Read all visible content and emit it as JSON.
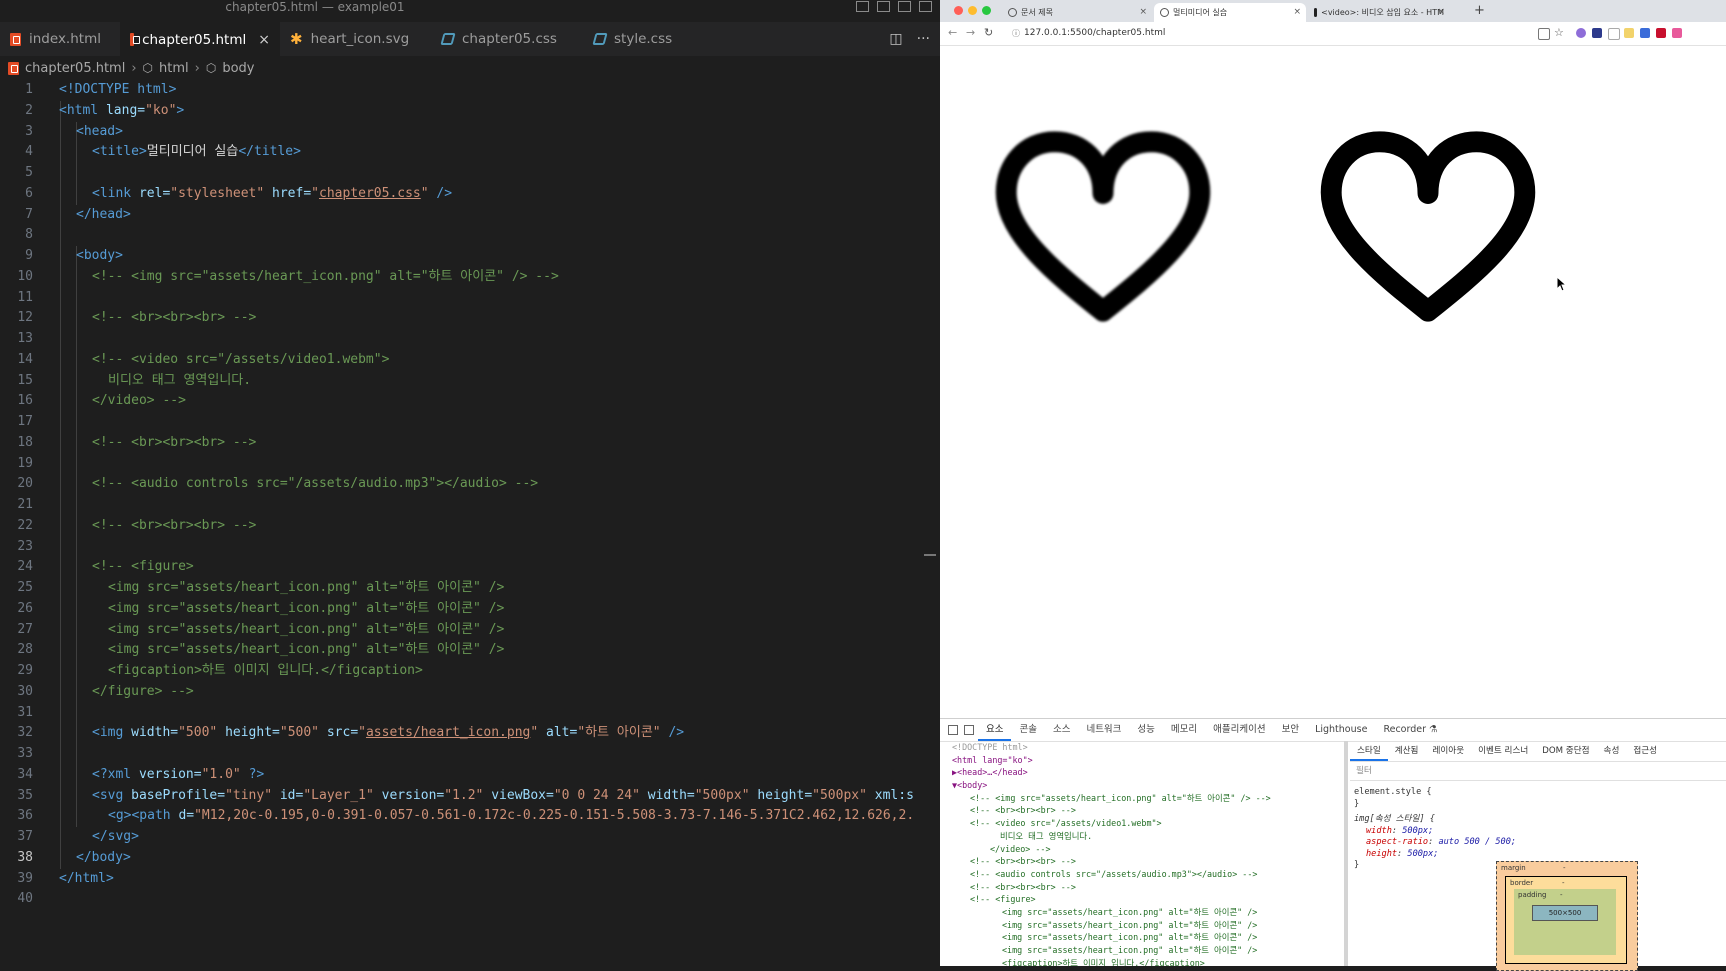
{
  "editor": {
    "window_title": "chapter05.html — example01",
    "tabs": [
      {
        "label": "index.html",
        "icon": "html-file-icon"
      },
      {
        "label": "chapter05.html",
        "icon": "html-file-icon",
        "active": true
      },
      {
        "label": "heart_icon.svg",
        "icon": "svg-file-icon"
      },
      {
        "label": "chapter05.css",
        "icon": "css-file-icon"
      },
      {
        "label": "style.css",
        "icon": "css-file-icon"
      }
    ],
    "tab_close": "×",
    "actions": {
      "split": "◫",
      "more": "···"
    },
    "breadcrumb": {
      "file": "chapter05.html",
      "html": "html",
      "body": "body"
    },
    "lines": {
      "l1": "<!DOCTYPE html>",
      "l2_tag": "<html ",
      "l2_attr": "lang=",
      "l2_val": "\"ko\"",
      "l2_end": ">",
      "l3": "<head>",
      "l4_tag1": "<title>",
      "l4_text": "멀티미디어 실습",
      "l4_tag2": "</title>",
      "l6_tag": "<link ",
      "l6_a1": "rel=",
      "l6_v1": "\"stylesheet\" ",
      "l6_a2": "href=",
      "l6_v2q": "\"",
      "l6_v2": "chapter05.css",
      "l6_v2e": "\" ",
      "l6_end": "/>",
      "l7": "</head>",
      "l9": "<body>",
      "l10": "<!-- <img src=\"assets/heart_icon.png\" alt=\"하트 아이콘\" /> -->",
      "l12": "<!-- <br><br><br> -->",
      "l14": "<!-- <video src=\"/assets/video1.webm\">",
      "l15": "비디오 태그 영역입니다.",
      "l16": "</video> -->",
      "l18": "<!-- <br><br><br> -->",
      "l20": "<!-- <audio controls src=\"/assets/audio.mp3\"></audio> -->",
      "l22": "<!-- <br><br><br> -->",
      "l24": "<!-- <figure>",
      "l25": "<img src=\"assets/heart_icon.png\" alt=\"하트 아이콘\" />",
      "l26": "<img src=\"assets/heart_icon.png\" alt=\"하트 아이콘\" />",
      "l27": "<img src=\"assets/heart_icon.png\" alt=\"하트 아이콘\" />",
      "l28": "<img src=\"assets/heart_icon.png\" alt=\"하트 아이콘\" />",
      "l29": "<figcaption>하트 이미지 입니다.</figcaption>",
      "l30": "</figure> -->",
      "l32_tag": "<img ",
      "l32_a1": "width=",
      "l32_v1": "\"500\" ",
      "l32_a2": "height=",
      "l32_v2": "\"500\" ",
      "l32_a3": "src=",
      "l32_v3q": "\"",
      "l32_v3": "assets/heart_icon.png",
      "l32_v3e": "\" ",
      "l32_a4": "alt=",
      "l32_v4": "\"하트 아이콘\" ",
      "l32_end": "/>",
      "l34_tag": "<?xml ",
      "l34_a": "version=",
      "l34_v": "\"1.0\" ",
      "l34_end": "?>",
      "l35_tag": "<svg ",
      "l35_a1": "baseProfile=",
      "l35_v1": "\"tiny\" ",
      "l35_a2": "id=",
      "l35_v2": "\"Layer_1\" ",
      "l35_a3": "version=",
      "l35_v3": "\"1.2\" ",
      "l35_a4": "viewBox=",
      "l35_v4": "\"0 0 24 24\" ",
      "l35_a5": "width=",
      "l35_v5": "\"500px\" ",
      "l35_a6": "height=",
      "l35_v6": "\"500px\" ",
      "l35_a7": "xml:s",
      "l36_tag": "<g><path ",
      "l36_a": "d=",
      "l36_v": "\"M12,20c-0.195,0-0.391-0.057-0.561-0.172c-0.225-0.151-5.508-3.73-7.146-5.371C2.462,12.626,2.",
      "l37": "</svg>",
      "l38": "</body>",
      "l39": "</html>"
    }
  },
  "browser": {
    "tabs": [
      {
        "label": "문서 제목"
      },
      {
        "label": "멀티미디어 실습",
        "active": true
      },
      {
        "label": "<video>: 비디오 삽입 요소 - HTM"
      }
    ],
    "tab_close": "×",
    "new_tab": "+",
    "url": "127.0.0.1:5500/chapter05.html",
    "nav": {
      "back": "←",
      "forward": "→",
      "reload": "↻"
    },
    "heart_alt": "하트 아이콘"
  },
  "devtools": {
    "tabs": [
      "요소",
      "콘솔",
      "소스",
      "네트워크",
      "성능",
      "메모리",
      "애플리케이션",
      "보안",
      "Lighthouse",
      "Recorder ⚗"
    ],
    "dom": {
      "d1": "<!DOCTYPE html>",
      "d2": "<html lang=\"ko\">",
      "d3": "▶<head>…</head>",
      "d4": "▼<body>",
      "d5": "<!-- <img src=\"assets/heart_icon.png\" alt=\"하트 아이콘\" /> -->",
      "d6": "<!-- <br><br><br> -->",
      "d7": "<!-- <video src=\"/assets/video1.webm\">",
      "d8": "비디오 태그 영역입니다.",
      "d9": "</video> -->",
      "d10": "<!-- <br><br><br> -->",
      "d11": "<!-- <audio controls src=\"/assets/audio.mp3\"></audio> -->",
      "d12": "<!-- <br><br><br> -->",
      "d13": "<!-- <figure>",
      "d14": "<img src=\"assets/heart_icon.png\" alt=\"하트 아이콘\" />",
      "d15": "<img src=\"assets/heart_icon.png\" alt=\"하트 아이콘\" />",
      "d16": "<img src=\"assets/heart_icon.png\" alt=\"하트 아이콘\" />",
      "d17": "<img src=\"assets/heart_icon.png\" alt=\"하트 아이콘\" />",
      "d18": "<figcaption>하트 이미지 입니다.</figcaption>"
    },
    "styles_tabs": [
      "스타일",
      "계산됨",
      "레이아웃",
      "이벤트 리스너",
      "DOM 중단점",
      "속성",
      "접근성"
    ],
    "filter_placeholder": "필터",
    "rules": {
      "r1": "element.style {",
      "r2": "}",
      "r3": "img[속성 스타일] {",
      "r4n": "width",
      "r4v": "500px;",
      "r5n": "aspect-ratio",
      "r5v": "auto 500 / 500;",
      "r6n": "height",
      "r6v": "500px;",
      "r7": "}"
    },
    "box_model": {
      "margin": "margin",
      "border": "border",
      "padding": "padding",
      "content": "500×500",
      "dash": "-"
    }
  }
}
